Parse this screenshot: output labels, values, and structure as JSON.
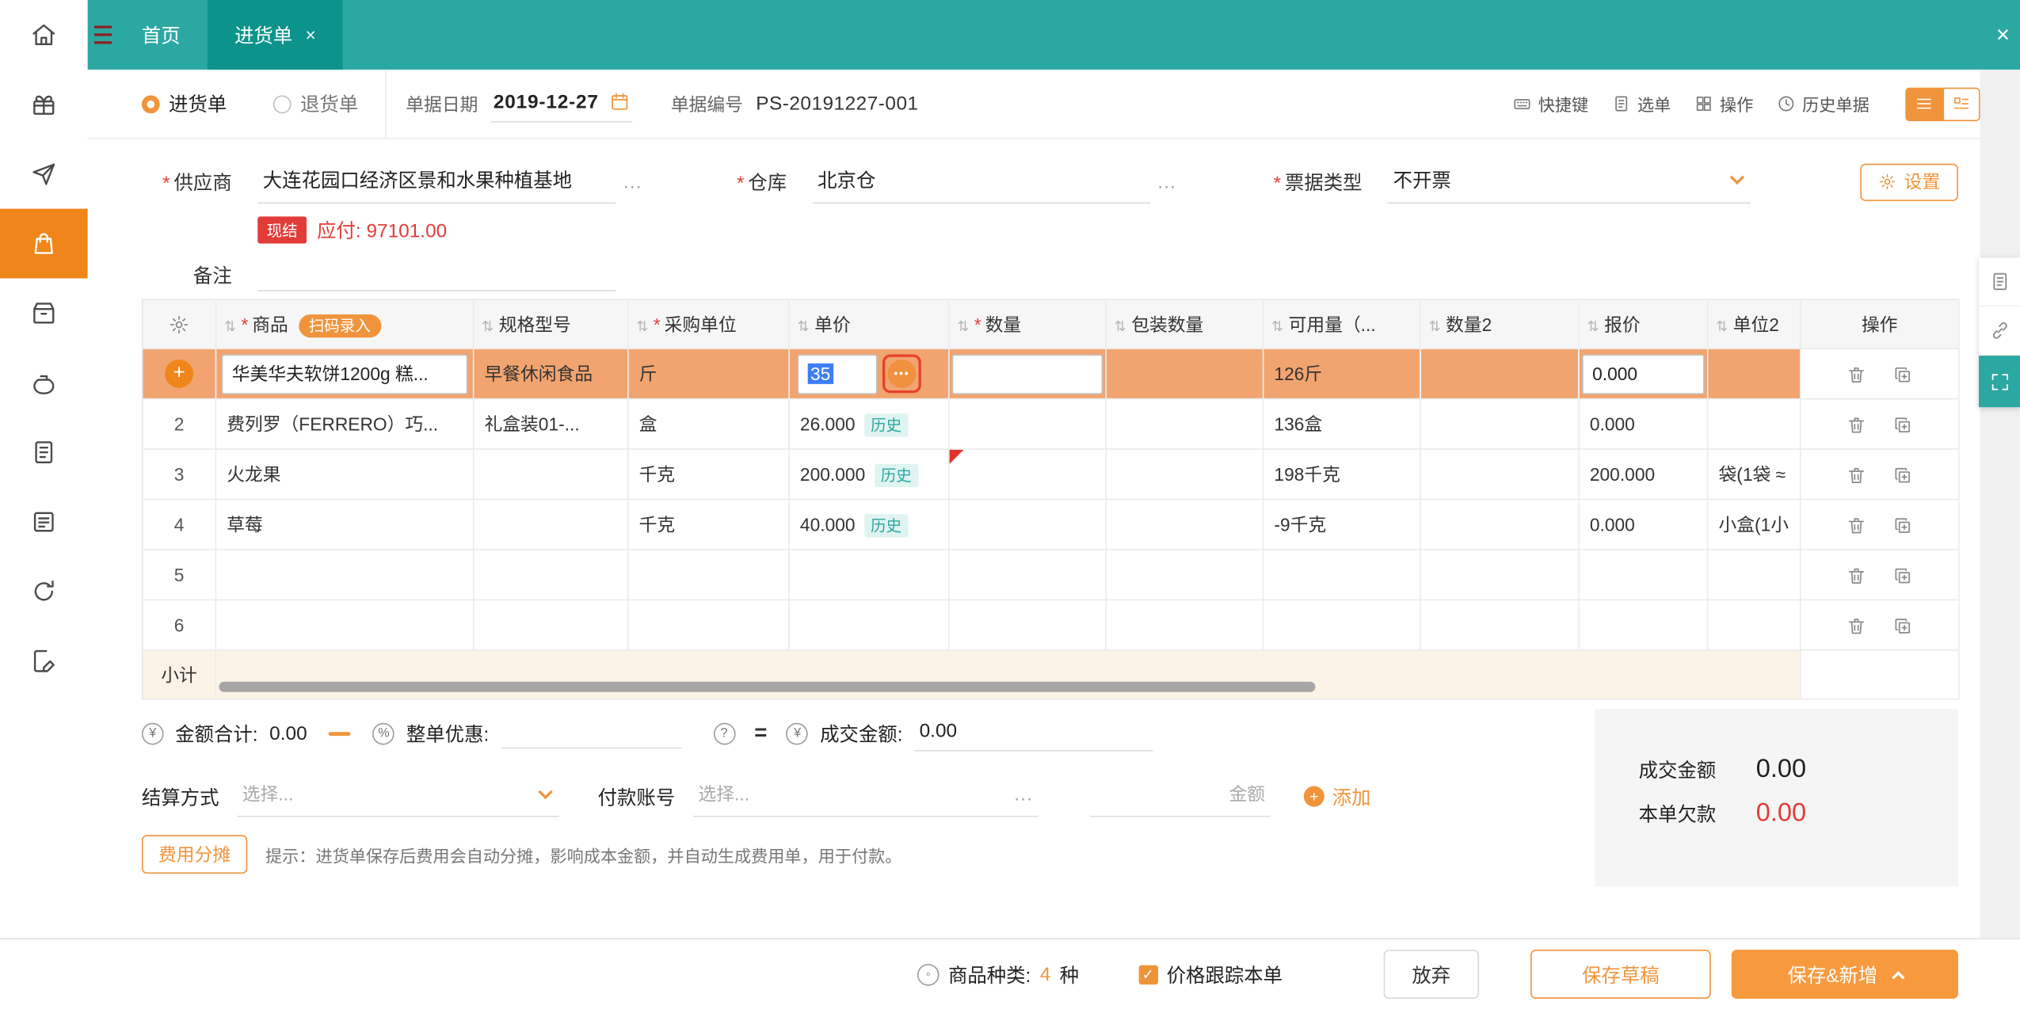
{
  "colors": {
    "teal": "#2BA8A1",
    "teal_dark": "#0C938C",
    "orange": "#F0943C",
    "orange_deep": "#F08519",
    "row_highlight": "#F1A46F",
    "red": "#E23C39",
    "history_teal": "#2AA7A0"
  },
  "topbar": {
    "home_tab": "首页",
    "active_tab": "进货单",
    "tab_close": "×",
    "bar_close": "×"
  },
  "doc_toolbar": {
    "radio_purchase": "进货单",
    "radio_return": "退货单",
    "date_label": "单据日期",
    "date_value": "2019-12-27",
    "no_label": "单据编号",
    "no_value": "PS-20191227-001",
    "shortcut_label": "快捷键",
    "pick_label": "选单",
    "ops_label": "操作",
    "history_label": "历史单据"
  },
  "form": {
    "supplier_label": "供应商",
    "supplier_value": "大连花园口经济区景和水果种植基地",
    "supplier_more": "...",
    "warehouse_label": "仓库",
    "warehouse_value": "北京仓",
    "warehouse_more": "...",
    "invoice_label": "票据类型",
    "invoice_value": "不开票",
    "settings_label": "设置",
    "cash_badge": "现结",
    "payable_label": "应付:",
    "payable_value": "97101.00",
    "remark_label": "备注"
  },
  "table": {
    "scan_badge": "扫码录入",
    "history_badge": "历史",
    "headers": {
      "product": "商品",
      "spec": "规格型号",
      "unit": "采购单位",
      "price": "单价",
      "qty": "数量",
      "pack_qty": "包装数量",
      "available": "可用量（...",
      "qty2": "数量2",
      "quote": "报价",
      "unit2": "单位2",
      "actions": "操作"
    },
    "rows": [
      {
        "product": "华美华夫软饼1200g 糕...",
        "spec": "早餐休闲食品",
        "unit": "斤",
        "price": "35",
        "qty": "",
        "pack_qty": "",
        "available": "126斤",
        "qty2": "",
        "quote": "0.000",
        "unit2": ""
      },
      {
        "index": "2",
        "product": "费列罗（FERRERO）巧...",
        "spec": "礼盒装01-...",
        "unit": "盒",
        "price": "26.000",
        "qty": "",
        "pack_qty": "",
        "available": "136盒",
        "qty2": "",
        "quote": "0.000",
        "unit2": ""
      },
      {
        "index": "3",
        "product": "火龙果",
        "spec": "",
        "unit": "千克",
        "price": "200.000",
        "qty": "",
        "pack_qty": "",
        "available": "198千克",
        "qty2": "",
        "quote": "200.000",
        "unit2": "袋(1袋 ≈"
      },
      {
        "index": "4",
        "product": "草莓",
        "spec": "",
        "unit": "千克",
        "price": "40.000",
        "qty": "",
        "pack_qty": "",
        "available": "-9千克",
        "qty2": "",
        "quote": "0.000",
        "unit2": "小盒(1小"
      },
      {
        "index": "5"
      },
      {
        "index": "6"
      }
    ],
    "subtotal_label": "小计"
  },
  "totals": {
    "amount_icon": "¥",
    "amount_label": "金额合计:",
    "amount_value": "0.00",
    "discount_icon": "%",
    "discount_label": "整单优惠:",
    "help_icon": "?",
    "equals": "=",
    "deal_icon": "¥",
    "deal_label": "成交金额:",
    "deal_value": "0.00"
  },
  "payment": {
    "method_label": "结算方式",
    "method_placeholder": "选择...",
    "account_label": "付款账号",
    "account_placeholder": "选择...",
    "account_more": "...",
    "amount_placeholder": "金额",
    "add_label": "添加"
  },
  "fee": {
    "button": "费用分摊",
    "tip": "提示：进货单保存后费用会自动分摊，影响成本金额，并自动生成费用单，用于付款。"
  },
  "summary": {
    "deal_label": "成交金额",
    "deal_value": "0.00",
    "debt_label": "本单欠款",
    "debt_value": "0.00"
  },
  "footer": {
    "kinds_label": "商品种类:",
    "kinds_value": "4",
    "kinds_unit": "种",
    "track_label": "价格跟踪本单",
    "abandon": "放弃",
    "save_draft": "保存草稿",
    "save_new": "保存&新增"
  }
}
